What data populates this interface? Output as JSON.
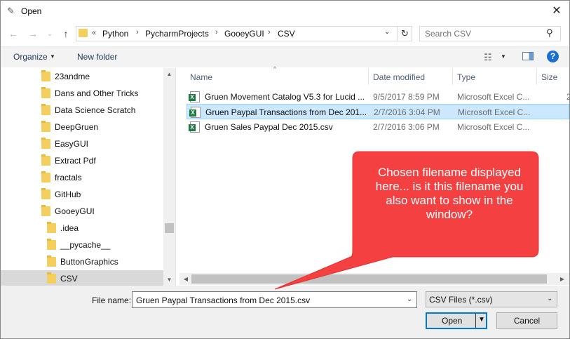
{
  "window": {
    "title": "Open",
    "close_glyph": "✕",
    "title_icon": "feather-icon"
  },
  "address": {
    "prefix": "«",
    "breadcrumb": [
      "Python",
      "PycharmProjects",
      "GooeyGUI",
      "CSV"
    ],
    "separator": "›",
    "search_placeholder": "Search CSV"
  },
  "toolbar": {
    "organize_label": "Organize",
    "new_folder_label": "New folder",
    "help_glyph": "?"
  },
  "nav": {
    "items": [
      {
        "label": "23andme"
      },
      {
        "label": "Dans and Other Tricks"
      },
      {
        "label": "Data Science Scratch"
      },
      {
        "label": "DeepGruen"
      },
      {
        "label": "EasyGUI"
      },
      {
        "label": "Extract Pdf"
      },
      {
        "label": "fractals"
      },
      {
        "label": "GitHub"
      },
      {
        "label": "GooeyGUI"
      },
      {
        "label": ".idea"
      },
      {
        "label": "__pycache__"
      },
      {
        "label": "ButtonGraphics"
      },
      {
        "label": "CSV"
      }
    ]
  },
  "filelist": {
    "columns": [
      "Name",
      "Date modified",
      "Type",
      "Size"
    ],
    "rows": [
      {
        "name": "Gruen Movement Catalog V5.3 for Lucid ...",
        "date": "9/5/2017 8:59 PM",
        "type": "Microsoft Excel C...",
        "size": "2"
      },
      {
        "name": "Gruen Paypal Transactions from Dec 201...",
        "date": "2/7/2016 3:04 PM",
        "type": "Microsoft Excel C...",
        "size": "",
        "selected": true
      },
      {
        "name": "Gruen Sales Paypal Dec 2015.csv",
        "date": "2/7/2016 3:06 PM",
        "type": "Microsoft Excel C...",
        "size": ""
      }
    ]
  },
  "bottom": {
    "filename_label": "File name:",
    "filename_value": "Gruen Paypal Transactions from Dec 2015.csv",
    "filetype_value": "CSV Files (*.csv)",
    "open_label": "Open",
    "cancel_label": "Cancel"
  },
  "callout": {
    "text": "Chosen filename displayed here... is it this filename you also want to show in the window?",
    "color": "#f44040"
  }
}
